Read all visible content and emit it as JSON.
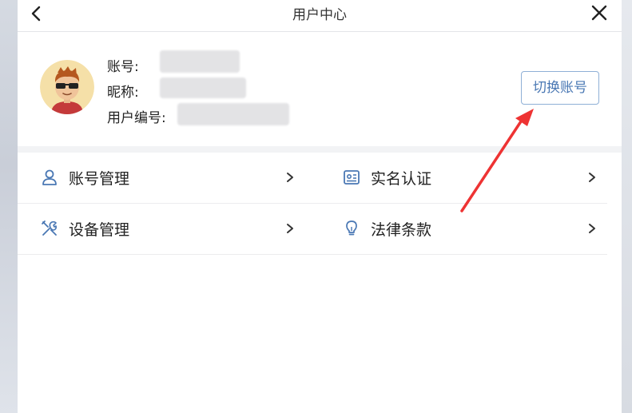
{
  "header": {
    "title": "用户中心",
    "back_icon": "chevron-left-icon",
    "close_icon": "close-icon"
  },
  "profile": {
    "account_label": "账号:",
    "nickname_label": "昵称:",
    "user_id_label": "用户编号:",
    "switch_button": "切换账号"
  },
  "menu": {
    "items": [
      {
        "label": "账号管理",
        "icon": "user-icon"
      },
      {
        "label": "实名认证",
        "icon": "id-card-icon"
      },
      {
        "label": "设备管理",
        "icon": "tools-icon"
      },
      {
        "label": "法律条款",
        "icon": "lightbulb-icon"
      }
    ]
  },
  "colors": {
    "accent": "#4a78b4",
    "annotation_arrow": "#ee3333"
  }
}
